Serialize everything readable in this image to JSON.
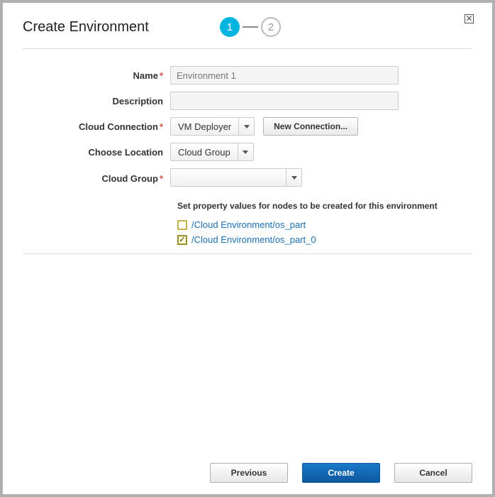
{
  "dialog": {
    "title": "Create Environment",
    "steps": {
      "current": "1",
      "next": "2"
    }
  },
  "form": {
    "name": {
      "label": "Name",
      "required": true,
      "placeholder": "Environment 1",
      "value": ""
    },
    "description": {
      "label": "Description",
      "required": false,
      "value": ""
    },
    "cloudConnection": {
      "label": "Cloud Connection",
      "required": true,
      "selected": "VM Deployer",
      "newConnectionButton": "New Connection..."
    },
    "chooseLocation": {
      "label": "Choose Location",
      "required": false,
      "selected": "Cloud Group"
    },
    "cloudGroup": {
      "label": "Cloud Group",
      "required": true,
      "selected": ""
    }
  },
  "propertySection": {
    "heading": "Set property values for nodes to be created for this environment",
    "nodes": [
      {
        "path": "/Cloud Environment/os_part",
        "checked": false
      },
      {
        "path": "/Cloud Environment/os_part_0",
        "checked": true
      }
    ]
  },
  "footer": {
    "previous": "Previous",
    "create": "Create",
    "cancel": "Cancel"
  }
}
